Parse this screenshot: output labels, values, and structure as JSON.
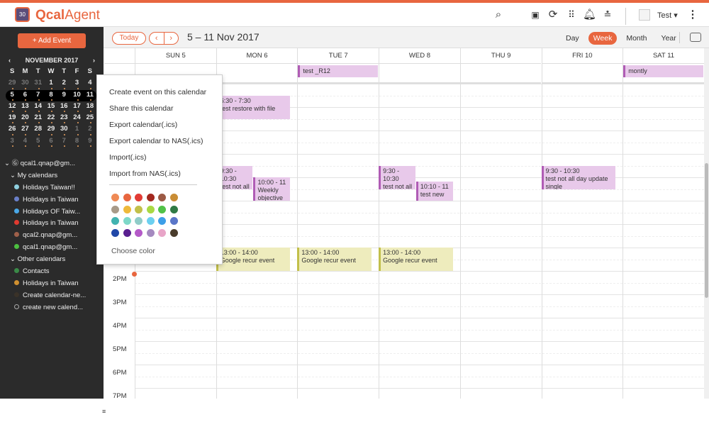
{
  "app": {
    "name_bold": "Qcal",
    "name_rest": "Agent",
    "logo_text": "30",
    "accent": "#e8663f"
  },
  "header": {
    "icons": [
      "search-icon",
      "screen-record-icon",
      "refresh-icon",
      "apps-grid-icon",
      "bell-icon",
      "stack-icon"
    ],
    "user": "Test ▾",
    "more": "⋮"
  },
  "sidebar": {
    "add_event": "+   Add Event",
    "month_title": "NOVEMBER 2017",
    "prev": "‹",
    "next": "›",
    "weekdays": [
      "S",
      "M",
      "T",
      "W",
      "T",
      "F",
      "S"
    ],
    "weeks": [
      [
        "29",
        "30",
        "31",
        "1",
        "2",
        "3",
        "4"
      ],
      [
        "5",
        "6",
        "7",
        "8",
        "9",
        "10",
        "11"
      ],
      [
        "12",
        "13",
        "14",
        "15",
        "16",
        "17",
        "18"
      ],
      [
        "19",
        "20",
        "21",
        "22",
        "23",
        "24",
        "25"
      ],
      [
        "26",
        "27",
        "28",
        "29",
        "30",
        "1",
        "2"
      ],
      [
        "3",
        "4",
        "5",
        "6",
        "7",
        "8",
        "9"
      ]
    ],
    "account": "qcal1.qnap@gm...",
    "my_calendars_label": "My calendars",
    "my_calendars": [
      {
        "name": "Holidays Taiwan!!",
        "color": "#8fd0e0"
      },
      {
        "name": "Holidays in Taiwan",
        "color": "#6a7fc8"
      },
      {
        "name": "Holidays OF Taiw...",
        "color": "#4aa8e8"
      },
      {
        "name": "Holidays in Taiwan",
        "color": "#e03a30"
      },
      {
        "name": "qcal2.qnap@gm...",
        "color": "#a0604a"
      },
      {
        "name": "qcal1.qnap@gm...",
        "color": "#4cc040"
      }
    ],
    "other_calendars_label": "Other calendars",
    "other_calendars": [
      {
        "name": "Contacts",
        "color": "#3a8a48"
      },
      {
        "name": "Holidays in Taiwan",
        "color": "#d09030"
      },
      {
        "name": "Create calendar-ne...",
        "color": "#3a3228"
      },
      {
        "name": "create new calend...",
        "color": "outline"
      }
    ]
  },
  "toolbar": {
    "today": "Today",
    "prev": "‹",
    "next": "›",
    "range": "5 – 11 Nov 2017",
    "views": [
      "Day",
      "Week",
      "Month",
      "Year"
    ],
    "active_view": "Week"
  },
  "days": [
    "SUN 5",
    "MON 6",
    "TUE 7",
    "WED 8",
    "THU 9",
    "FRI 10",
    "SAT 11"
  ],
  "hours": [
    {
      "label": "2PM",
      "h": 14
    },
    {
      "label": "3PM",
      "h": 15
    },
    {
      "label": "4PM",
      "h": 16
    },
    {
      "label": "5PM",
      "h": 17
    },
    {
      "label": "6PM",
      "h": 18
    },
    {
      "label": "7PM",
      "h": 19
    }
  ],
  "allday_events": [
    {
      "day": 2,
      "title": "test _R12"
    },
    {
      "day": 6,
      "title": "montly"
    }
  ],
  "events": [
    {
      "day": 1,
      "start": 6.5,
      "end": 7.5,
      "time": "6:30 - 7:30",
      "title": "test restore with file",
      "col": 0,
      "cols": 1,
      "color": "purple"
    },
    {
      "day": 1,
      "start": 9.5,
      "end": 10.5,
      "time": "9:30 - 10:30",
      "title": "test not all day",
      "col": 0,
      "cols": 2,
      "color": "purple"
    },
    {
      "day": 1,
      "start": 10,
      "end": 11,
      "time": "10:00 - 11",
      "title": "Weekly objective",
      "col": 1,
      "cols": 2,
      "color": "purple"
    },
    {
      "day": 3,
      "start": 9.5,
      "end": 10.5,
      "time": "9:30 - 10:30",
      "title": "test not all day",
      "col": 0,
      "cols": 2,
      "color": "purple"
    },
    {
      "day": 3,
      "start": 10.17,
      "end": 11,
      "time": "10:10 - 11",
      "title": "test new",
      "col": 1,
      "cols": 2,
      "color": "purple"
    },
    {
      "day": 5,
      "start": 9.5,
      "end": 10.5,
      "time": "9:30 - 10:30",
      "title": "test not all day update single",
      "col": 0,
      "cols": 1,
      "color": "purple"
    },
    {
      "day": 1,
      "start": 13,
      "end": 14,
      "time": "13:00 - 14:00",
      "title": "Google recur event",
      "col": 0,
      "cols": 1,
      "color": "yellow"
    },
    {
      "day": 2,
      "start": 13,
      "end": 14,
      "time": "13:00 - 14:00",
      "title": "Google recur event",
      "col": 0,
      "cols": 1,
      "color": "yellow"
    },
    {
      "day": 3,
      "start": 13,
      "end": 14,
      "time": "13:00 - 14:00",
      "title": "Google recur event",
      "col": 0,
      "cols": 1,
      "color": "yellow"
    }
  ],
  "context_menu": {
    "items": [
      "Create event on this calendar",
      "Share this calendar",
      "Export calendar(.ics)",
      "Export calendar to NAS(.ics)",
      "Import(.ics)",
      "Import from NAS(.ics)"
    ],
    "swatches": [
      "#ef8a55",
      "#e8663f",
      "#e23c35",
      "#a3281f",
      "#9c5a45",
      "#c98d35",
      "#a89a88",
      "#eeb93a",
      "#c2c04a",
      "#a9d944",
      "#52c248",
      "#2f7a45",
      "#42b3b0",
      "#7ed8c8",
      "#90ccc8",
      "#6cd0f0",
      "#3d9fe8",
      "#5a76c8",
      "#2048a8",
      "#5a1f90",
      "#b45ac8",
      "#a58ac0",
      "#e8a5c8",
      "#4a3c2c"
    ],
    "choose_color": "Choose color"
  }
}
